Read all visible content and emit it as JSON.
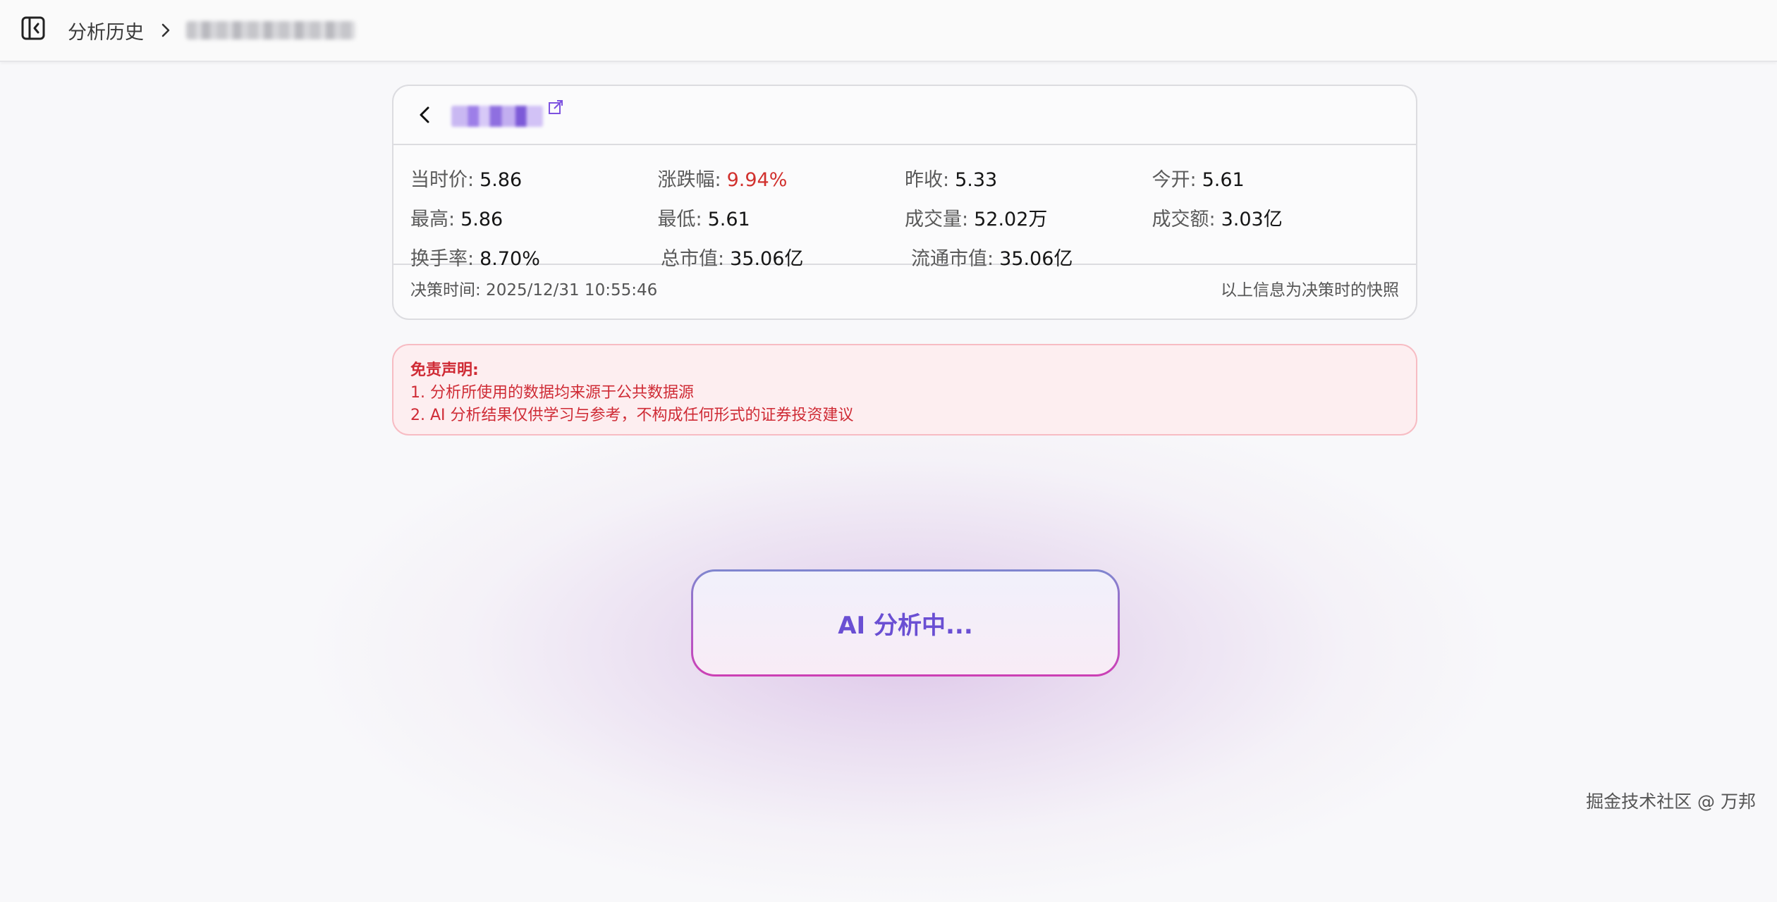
{
  "header": {
    "sidebar_toggle_icon": "panel-collapse-icon",
    "breadcrumb_root": "分析历史",
    "separator_icon": "chevron-right-icon"
  },
  "stock": {
    "back_icon": "chevron-left-icon",
    "external_link_icon": "external-link-icon",
    "stats": [
      [
        {
          "label": "当时价:",
          "value": "5.86"
        },
        {
          "label": "涨跌幅:",
          "value": "9.94%"
        },
        {
          "label": "昨收:",
          "value": "5.33"
        },
        {
          "label": "今开:",
          "value": "5.61"
        }
      ],
      [
        {
          "label": "最高:",
          "value": "5.86"
        },
        {
          "label": "最低:",
          "value": "5.61"
        },
        {
          "label": "成交量:",
          "value": "52.02万"
        },
        {
          "label": "成交额:",
          "value": "3.03亿"
        }
      ],
      [
        {
          "label": "换手率:",
          "value": "8.70%"
        },
        {
          "label": "总市值:",
          "value": "35.06亿"
        },
        {
          "label": "流通市值:",
          "value": "35.06亿"
        }
      ]
    ],
    "decision_time": "决策时间: 2025/12/31 10:55:46",
    "snapshot_note": "以上信息为决策时的快照",
    "up_color": "#d1312e"
  },
  "disclaimer": {
    "title": "免责声明:",
    "lines": [
      "1. 分析所使用的数据均来源于公共数据源",
      "2. AI 分析结果仅供学习与参考，不构成任何形式的证券投资建议"
    ]
  },
  "status": {
    "analyzing_label": "AI 分析中..."
  },
  "watermark": "掘金技术社区 @ 万邦",
  "colors": {
    "accent": "#6a4fd3",
    "disclaimer_text": "#cf2b35",
    "disclaimer_bg": "#fdeef0"
  }
}
